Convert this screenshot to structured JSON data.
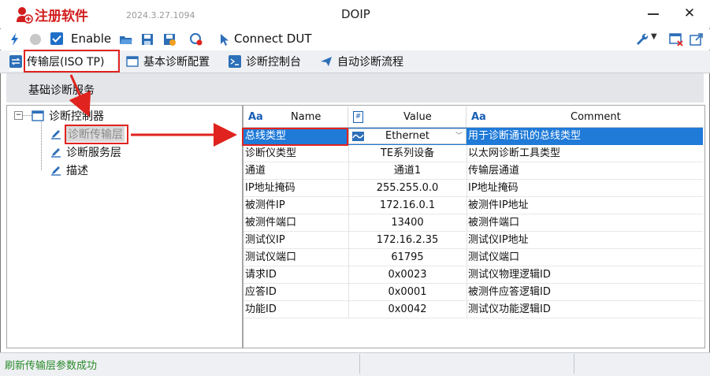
{
  "app": {
    "brand": "注册软件",
    "version": "2024.3.27.1094",
    "window_title": "DOIP"
  },
  "toolbar": {
    "enable_label": "Enable",
    "enable_checked": true,
    "connect_label": "Connect DUT"
  },
  "tabs": [
    {
      "label": "传输层(ISO TP)",
      "active": true,
      "icon": "swap-arrows-icon"
    },
    {
      "label": "基本诊断配置",
      "active": false,
      "icon": "window-icon"
    },
    {
      "label": "诊断控制台",
      "active": false,
      "icon": "console-icon"
    },
    {
      "label": "自动诊断流程",
      "active": false,
      "icon": "paper-plane-icon"
    }
  ],
  "subtab": {
    "label": "基础诊断服务"
  },
  "tree": {
    "root": "诊断控制器",
    "children": [
      "诊断传输层",
      "诊断服务层",
      "描述"
    ],
    "selected_index": 0
  },
  "table": {
    "columns": [
      {
        "label": "Name",
        "icon_text": "Aa"
      },
      {
        "label": "Value",
        "icon_text": "#"
      },
      {
        "label": "Comment",
        "icon_text": "Aa"
      }
    ],
    "rows": [
      {
        "name": "总线类型",
        "value": "Ethernet",
        "comment": "用于诊断通讯的总线类型",
        "selected": true
      },
      {
        "name": "诊断仪类型",
        "value": "TE系列设备",
        "comment": "以太网诊断工具类型"
      },
      {
        "name": "通道",
        "value": "通道1",
        "comment": "传输层通道"
      },
      {
        "name": "IP地址掩码",
        "value": "255.255.0.0",
        "comment": "IP地址掩码"
      },
      {
        "name": "被测件IP",
        "value": "172.16.0.1",
        "comment": "被测件IP地址"
      },
      {
        "name": "被测件端口",
        "value": "13400",
        "comment": "被测件端口"
      },
      {
        "name": "测试仪IP",
        "value": "172.16.2.35",
        "comment": "测试仪IP地址"
      },
      {
        "name": "测试仪端口",
        "value": "61795",
        "comment": "测试仪端口"
      },
      {
        "name": "请求ID",
        "value": "0x0023",
        "comment": "测试仪物理逻辑ID"
      },
      {
        "name": "应答ID",
        "value": "0x0001",
        "comment": "被测件应答逻辑ID"
      },
      {
        "name": "功能ID",
        "value": "0x0042",
        "comment": "测试仪功能逻辑ID"
      }
    ]
  },
  "status": {
    "message": "刷新传输层参数成功"
  },
  "colors": {
    "accent": "#1f7ad8",
    "highlight": "#e0231e",
    "status_text": "#2a8a2a"
  }
}
